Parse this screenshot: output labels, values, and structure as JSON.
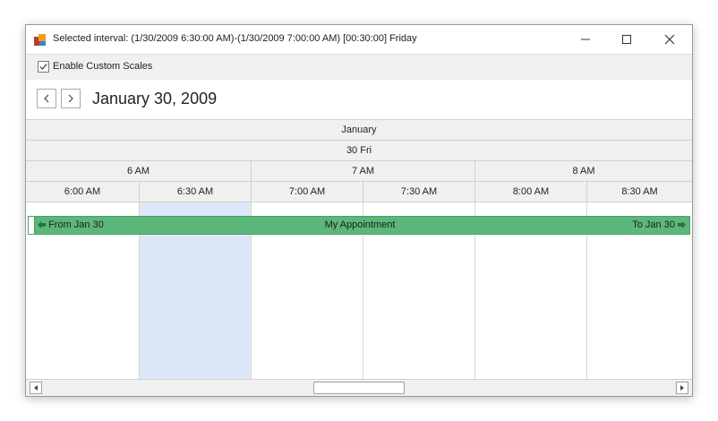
{
  "window": {
    "title": "Selected interval: (1/30/2009 6:30:00 AM)-(1/30/2009 7:00:00 AM) [00:30:00] Friday",
    "icon": "app-logo-icon",
    "controls": [
      "minimize-icon",
      "maximize-icon",
      "close-icon"
    ]
  },
  "toolbar": {
    "enable_custom_scales_label": "Enable Custom Scales",
    "enable_custom_scales_checked": true
  },
  "navigation": {
    "prev_icon": "chevron-left-icon",
    "next_icon": "chevron-right-icon",
    "date_caption": "January 30, 2009"
  },
  "scales": {
    "month": "January",
    "day": "30 Fri",
    "hours": [
      "6 AM",
      "7 AM",
      "8 AM"
    ],
    "slots": [
      "6:00 AM",
      "6:30 AM",
      "7:00 AM",
      "7:30 AM",
      "8:00 AM",
      "8:30 AM"
    ]
  },
  "selection": {
    "slot_label": "6:30 AM",
    "color": "#dce8f8"
  },
  "appointment": {
    "from_label": "From Jan 30",
    "subject": "My Appointment",
    "to_label": "To Jan 30",
    "color": "#5cb77a"
  },
  "colors": {
    "header_bg": "#f0f0f0",
    "border": "#d0d0d0"
  }
}
